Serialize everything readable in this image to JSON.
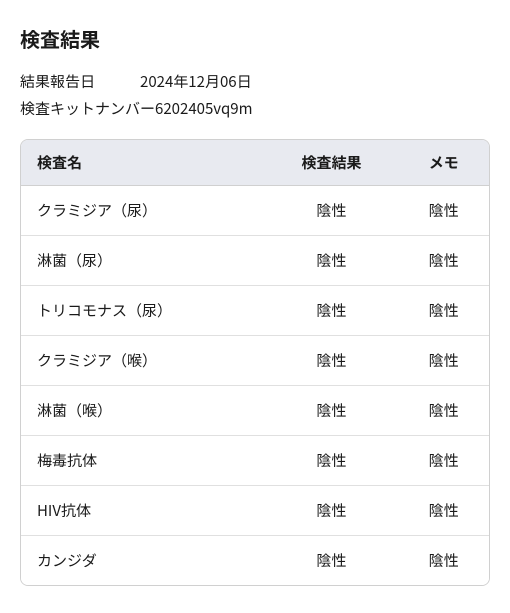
{
  "page": {
    "title": "検査結果"
  },
  "info": {
    "date_label": "結果報告日",
    "date_value": "2024年12月06日",
    "kit_label": "検査キットナンバー",
    "kit_value": "6202405vq9m"
  },
  "table": {
    "headers": {
      "name": "検査名",
      "result": "検査結果",
      "memo": "メモ"
    },
    "rows": [
      {
        "name": "クラミジア（尿）",
        "result": "陰性",
        "memo": "陰性"
      },
      {
        "name": "淋菌（尿）",
        "result": "陰性",
        "memo": "陰性"
      },
      {
        "name": "トリコモナス（尿）",
        "result": "陰性",
        "memo": "陰性"
      },
      {
        "name": "クラミジア（喉）",
        "result": "陰性",
        "memo": "陰性"
      },
      {
        "name": "淋菌（喉）",
        "result": "陰性",
        "memo": "陰性"
      },
      {
        "name": "梅毒抗体",
        "result": "陰性",
        "memo": "陰性"
      },
      {
        "name": "HIV抗体",
        "result": "陰性",
        "memo": "陰性"
      },
      {
        "name": "カンジダ",
        "result": "陰性",
        "memo": "陰性"
      }
    ]
  }
}
